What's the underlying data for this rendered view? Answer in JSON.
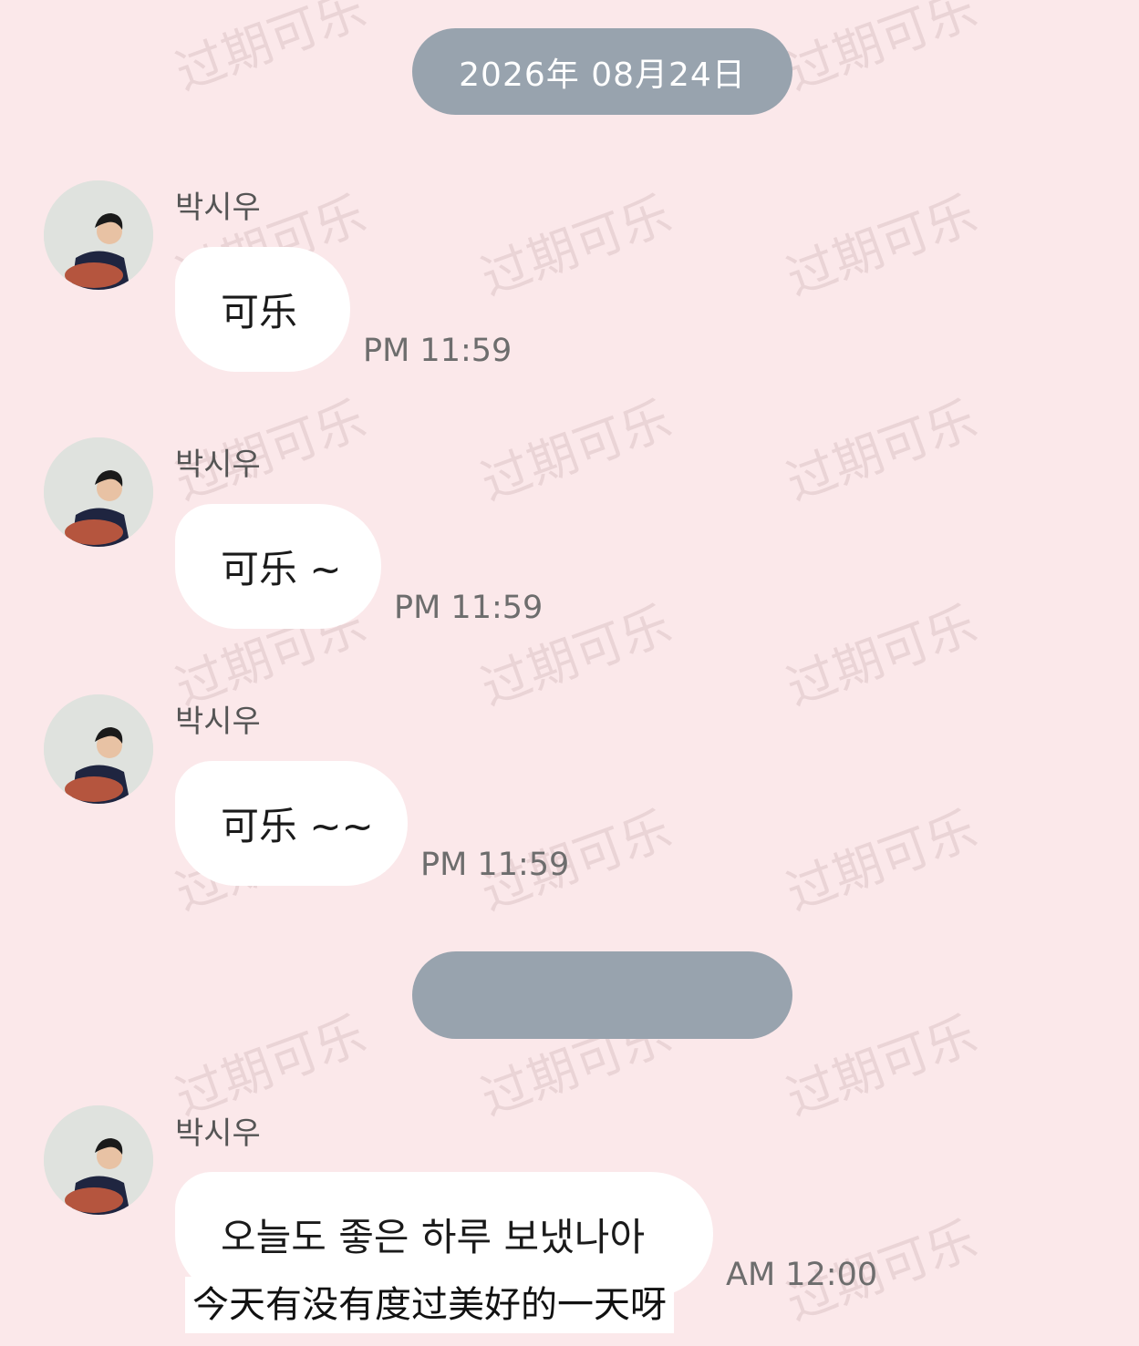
{
  "date_divider": "2026年 08月24日",
  "watermark_text": "过期可乐",
  "messages": [
    {
      "sender": "박시우",
      "text": "可乐",
      "time": "PM 11:59"
    },
    {
      "sender": "박시우",
      "text": "可乐 ~",
      "time": "PM 11:59"
    },
    {
      "sender": "박시우",
      "text": "可乐 ~~",
      "time": "PM 11:59"
    },
    {
      "sender": "박시우",
      "text": "오늘도 좋은 하루 보냈나아",
      "time": "AM 12:00"
    }
  ],
  "translation_subtitle": "今天有没有度过美好的一天呀",
  "colors": {
    "background": "#fbe8ea",
    "divider_pill": "#98a3ae",
    "bubble": "#ffffff"
  }
}
